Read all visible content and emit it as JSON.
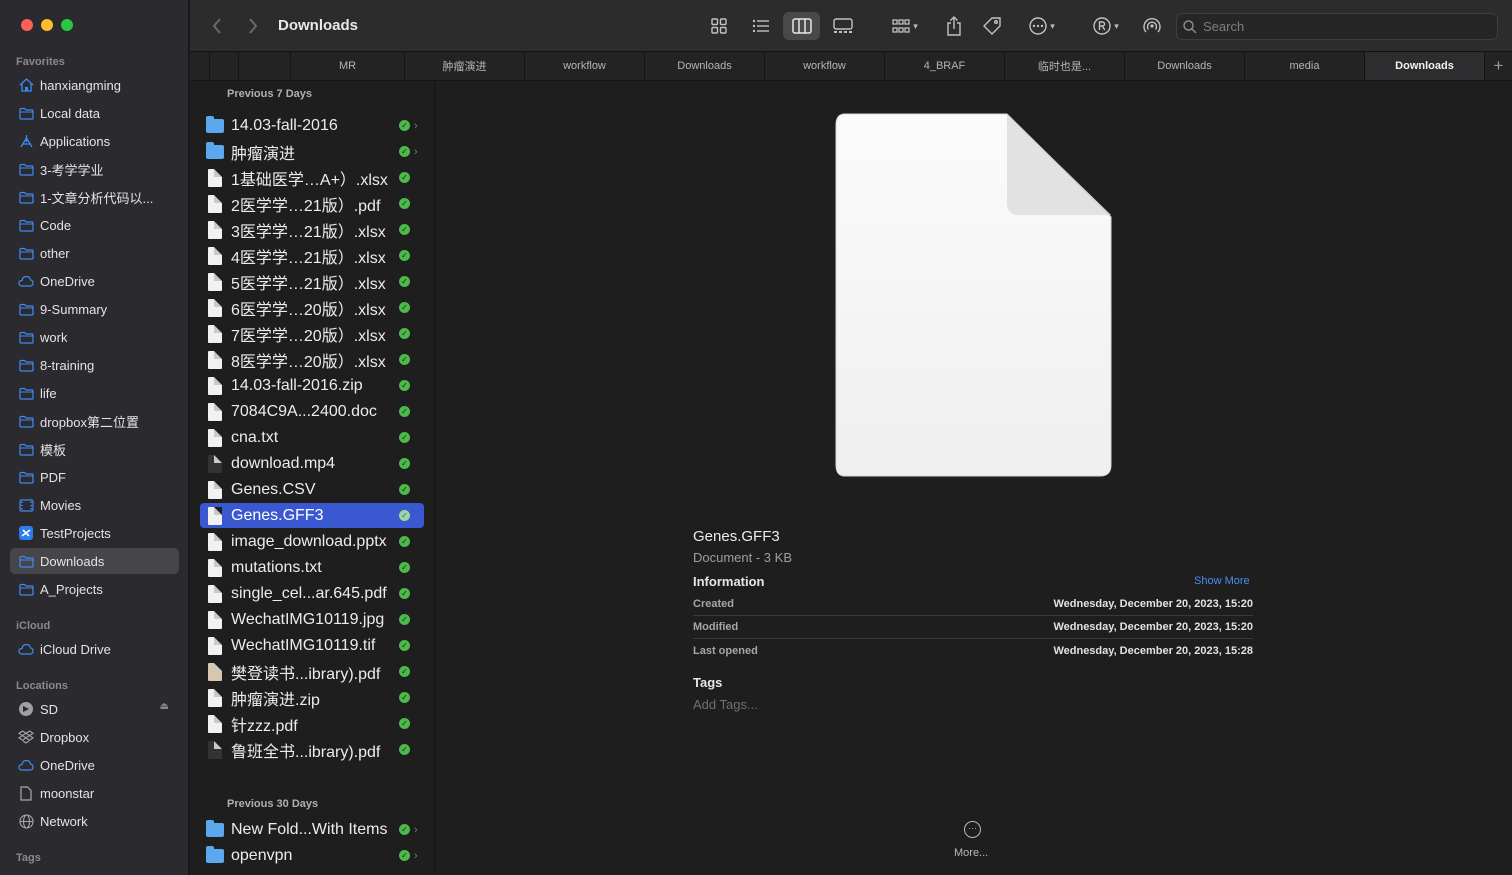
{
  "window": {
    "title": "Downloads"
  },
  "sidebar": {
    "favorites_header": "Favorites",
    "icloud_header": "iCloud",
    "locations_header": "Locations",
    "tags_header": "Tags",
    "favorites": [
      {
        "label": "hanxiangming",
        "icon": "home-icon"
      },
      {
        "label": "Local data",
        "icon": "folder-icon"
      },
      {
        "label": "Applications",
        "icon": "applications-icon"
      },
      {
        "label": "3-考学学业",
        "icon": "folder-icon"
      },
      {
        "label": "1-文章分析代码以...",
        "icon": "folder-icon"
      },
      {
        "label": "Code",
        "icon": "folder-icon"
      },
      {
        "label": "other",
        "icon": "folder-icon"
      },
      {
        "label": "OneDrive",
        "icon": "cloud-icon"
      },
      {
        "label": "9-Summary",
        "icon": "folder-icon"
      },
      {
        "label": "work",
        "icon": "folder-icon"
      },
      {
        "label": "8-training",
        "icon": "folder-icon"
      },
      {
        "label": "life",
        "icon": "folder-icon"
      },
      {
        "label": "dropbox第二位置",
        "icon": "folder-icon"
      },
      {
        "label": "模板",
        "icon": "folder-icon"
      },
      {
        "label": "PDF",
        "icon": "folder-icon"
      },
      {
        "label": "Movies",
        "icon": "film-icon"
      },
      {
        "label": "TestProjects",
        "icon": "xcode-icon"
      },
      {
        "label": "Downloads",
        "icon": "folder-icon"
      },
      {
        "label": "A_Projects",
        "icon": "folder-icon"
      }
    ],
    "icloud": [
      {
        "label": "iCloud Drive",
        "icon": "cloud-icon"
      }
    ],
    "locations": [
      {
        "label": "SD",
        "icon": "disk-icon"
      },
      {
        "label": "Dropbox",
        "icon": "dropbox-icon"
      },
      {
        "label": "OneDrive",
        "icon": "cloud-icon"
      },
      {
        "label": "moonstar",
        "icon": "document-icon"
      },
      {
        "label": "Network",
        "icon": "globe-icon"
      }
    ]
  },
  "search": {
    "placeholder": "Search"
  },
  "tabs": [
    "",
    "",
    "MR",
    "肿瘤演进",
    "workflow",
    "Downloads",
    "workflow",
    "4_BRAF",
    "临时也是...",
    "Downloads",
    "media",
    "Downloads"
  ],
  "column": {
    "sections": [
      "Previous 7 Days",
      "Previous 30 Days"
    ],
    "recent": [
      {
        "name": "14.03-fall-2016",
        "type": "folder"
      },
      {
        "name": "肿瘤演进",
        "type": "folder"
      },
      {
        "name": "1基础医学…A+）.xlsx",
        "type": "doc"
      },
      {
        "name": "2医学学…21版）.pdf",
        "type": "doc"
      },
      {
        "name": "3医学学…21版）.xlsx",
        "type": "doc"
      },
      {
        "name": "4医学学…21版）.xlsx",
        "type": "doc"
      },
      {
        "name": "5医学学…21版）.xlsx",
        "type": "doc"
      },
      {
        "name": "6医学学…20版）.xlsx",
        "type": "doc"
      },
      {
        "name": "7医学学…20版）.xlsx",
        "type": "doc"
      },
      {
        "name": "8医学学…20版）.xlsx",
        "type": "doc"
      },
      {
        "name": "14.03-fall-2016.zip",
        "type": "doc"
      },
      {
        "name": "7084C9A...2400.doc",
        "type": "doc"
      },
      {
        "name": "cna.txt",
        "type": "doc"
      },
      {
        "name": "download.mp4",
        "type": "dark"
      },
      {
        "name": "Genes.CSV",
        "type": "doc"
      },
      {
        "name": "Genes.GFF3",
        "type": "doc"
      },
      {
        "name": "image_download.pptx",
        "type": "doc"
      },
      {
        "name": "mutations.txt",
        "type": "doc"
      },
      {
        "name": "single_cel...ar.645.pdf",
        "type": "doc"
      },
      {
        "name": "WechatIMG10119.jpg",
        "type": "doc"
      },
      {
        "name": "WechatIMG10119.tif",
        "type": "doc"
      },
      {
        "name": "樊登读书...ibrary).pdf",
        "type": "img"
      },
      {
        "name": "肿瘤演进.zip",
        "type": "doc"
      },
      {
        "name": "针zzz.pdf",
        "type": "doc"
      },
      {
        "name": "鲁班全书...ibrary).pdf",
        "type": "dark"
      }
    ],
    "older": [
      {
        "name": "New Fold...With Items",
        "type": "folder"
      },
      {
        "name": "openvpn",
        "type": "folder"
      }
    ],
    "selected_name": "Genes.GFF3"
  },
  "preview": {
    "name": "Genes.GFF3",
    "kind": "Document - 3 KB",
    "info_header": "Information",
    "show_more": "Show More",
    "info": [
      {
        "key": "Created",
        "value": "Wednesday, December 20, 2023, 15:20"
      },
      {
        "key": "Modified",
        "value": "Wednesday, December 20, 2023, 15:20"
      },
      {
        "key": "Last opened",
        "value": "Wednesday, December 20, 2023, 15:28"
      }
    ],
    "tags_header": "Tags",
    "add_tags": "Add Tags...",
    "more": "More..."
  },
  "colors": {
    "selection": "#3a58d0",
    "accent": "#4a8ef8",
    "sidebar_icon": "#3d8bf2",
    "synced_check": "#4bb94b"
  }
}
